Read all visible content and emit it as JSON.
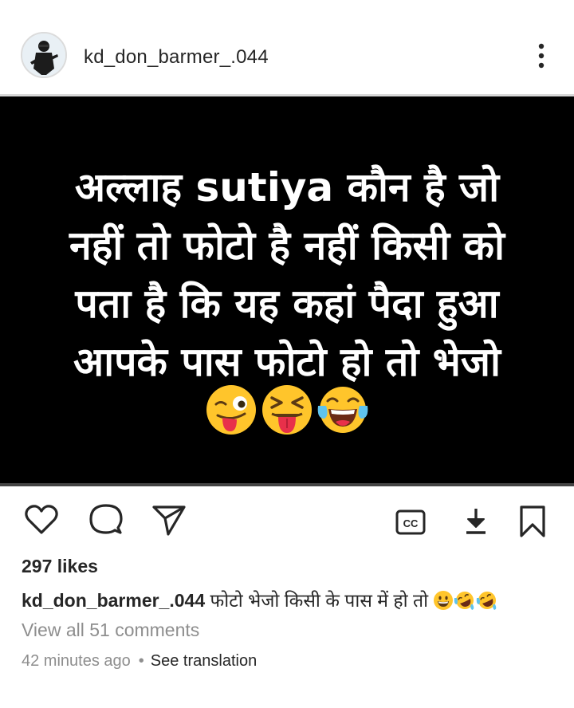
{
  "post": {
    "username": "kd_don_barmer_.044",
    "overlay_lines": [
      "अल्लाह sutiya कौन है जो",
      "नहीं तो फोटो है नहीं किसी को",
      "पता है कि यह कहां पैदा हुआ",
      "आपके पास फोटो हो तो भेजो"
    ],
    "overlay_emojis": [
      "winking-tongue-face",
      "squinting-tongue-face",
      "tears-of-joy-face"
    ],
    "likes": "297 likes",
    "caption_username": "kd_don_barmer_.044",
    "caption_text": "फोटो भेजो किसी के पास में हो तो",
    "caption_emojis": [
      "grinning-face",
      "rofl-face",
      "rofl-face"
    ],
    "view_comments": "View all 51 comments",
    "timestamp": "42 minutes ago",
    "separator": "•",
    "see_translation": "See translation"
  },
  "icons": {
    "like": "heart-icon",
    "comment": "comment-icon",
    "share": "send-icon",
    "captions": "cc-icon",
    "download": "download-icon",
    "save": "bookmark-icon",
    "more": "more-vertical-icon"
  },
  "colors": {
    "text": "#262626",
    "secondary": "#8e8e8e",
    "media_bg": "#000000",
    "emoji_yellow": "#ffc52b"
  }
}
